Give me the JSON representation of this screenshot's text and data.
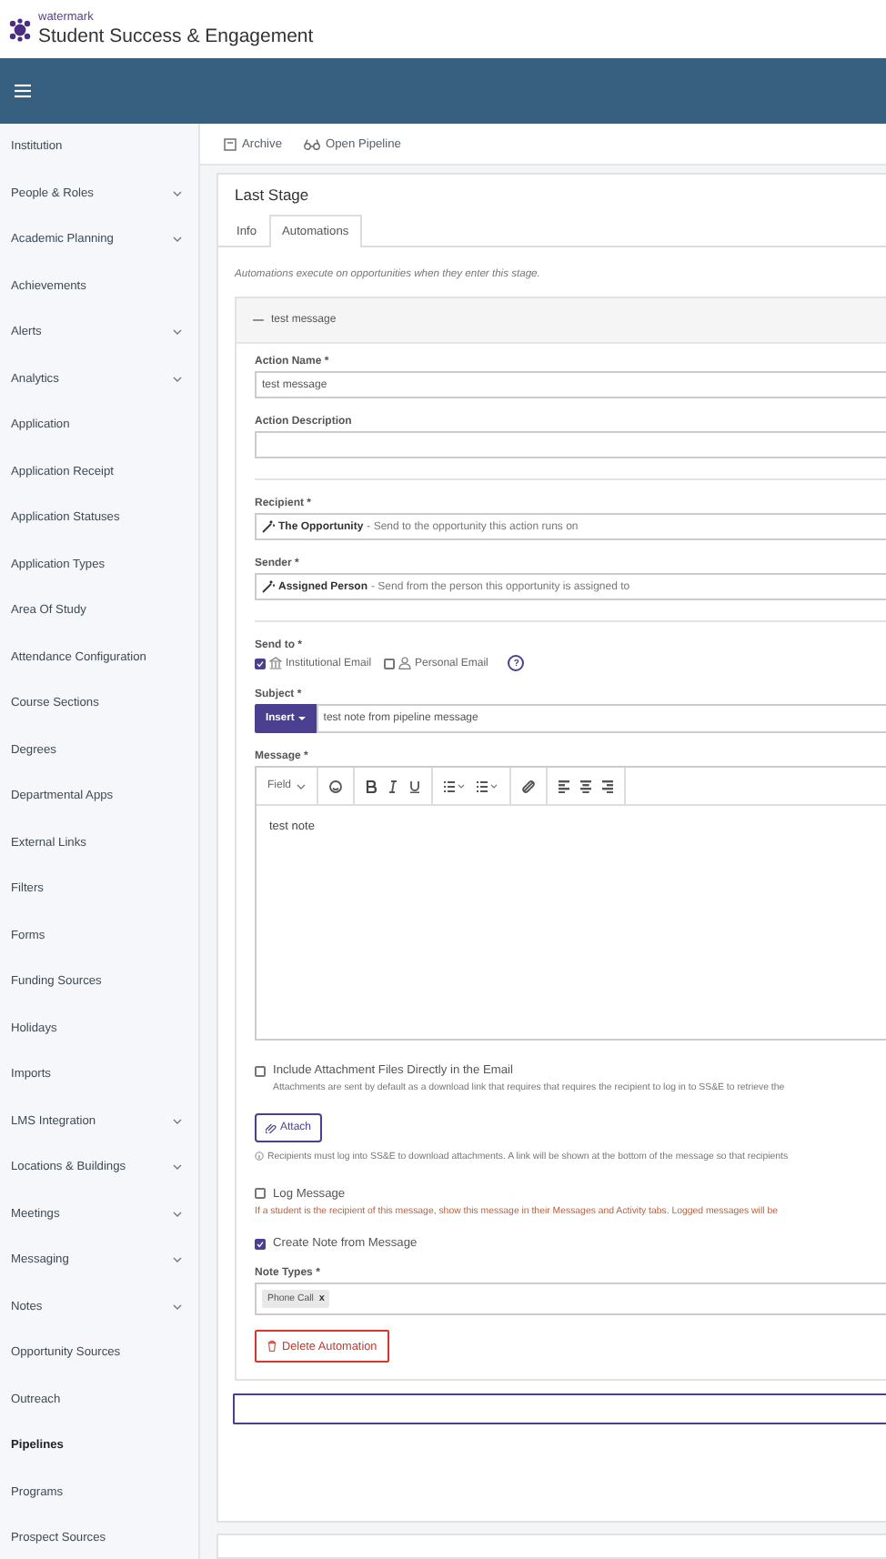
{
  "header": {
    "brand_small": "watermark",
    "brand": "Student Success & Engagement"
  },
  "sidebar": {
    "items": [
      {
        "label": "Institution",
        "expandable": false,
        "selected": false
      },
      {
        "label": "People & Roles",
        "expandable": true,
        "selected": false
      },
      {
        "label": "Academic Planning",
        "expandable": true,
        "selected": false
      },
      {
        "label": "Achievements",
        "expandable": false,
        "selected": false
      },
      {
        "label": "Alerts",
        "expandable": true,
        "selected": false
      },
      {
        "label": "Analytics",
        "expandable": true,
        "selected": false
      },
      {
        "label": "Application",
        "expandable": false,
        "selected": false
      },
      {
        "label": "Application Receipt",
        "expandable": false,
        "selected": false
      },
      {
        "label": "Application Statuses",
        "expandable": false,
        "selected": false
      },
      {
        "label": "Application Types",
        "expandable": false,
        "selected": false
      },
      {
        "label": "Area Of Study",
        "expandable": false,
        "selected": false
      },
      {
        "label": "Attendance Configuration",
        "expandable": false,
        "selected": false
      },
      {
        "label": "Course Sections",
        "expandable": false,
        "selected": false
      },
      {
        "label": "Degrees",
        "expandable": false,
        "selected": false
      },
      {
        "label": "Departmental Apps",
        "expandable": false,
        "selected": false
      },
      {
        "label": "External Links",
        "expandable": false,
        "selected": false
      },
      {
        "label": "Filters",
        "expandable": false,
        "selected": false
      },
      {
        "label": "Forms",
        "expandable": false,
        "selected": false
      },
      {
        "label": "Funding Sources",
        "expandable": false,
        "selected": false
      },
      {
        "label": "Holidays",
        "expandable": false,
        "selected": false
      },
      {
        "label": "Imports",
        "expandable": false,
        "selected": false
      },
      {
        "label": "LMS Integration",
        "expandable": true,
        "selected": false
      },
      {
        "label": "Locations & Buildings",
        "expandable": true,
        "selected": false
      },
      {
        "label": "Meetings",
        "expandable": true,
        "selected": false
      },
      {
        "label": "Messaging",
        "expandable": true,
        "selected": false
      },
      {
        "label": "Notes",
        "expandable": true,
        "selected": false
      },
      {
        "label": "Opportunity Sources",
        "expandable": false,
        "selected": false
      },
      {
        "label": "Outreach",
        "expandable": false,
        "selected": false
      },
      {
        "label": "Pipelines",
        "expandable": false,
        "selected": true
      },
      {
        "label": "Programs",
        "expandable": false,
        "selected": false
      },
      {
        "label": "Prospect Sources",
        "expandable": false,
        "selected": false
      }
    ]
  },
  "toolbar": [
    {
      "kind": "archive",
      "label": "Archive"
    },
    {
      "kind": "pipeline",
      "label": "Open Pipeline"
    }
  ],
  "stage": {
    "title": "Last Stage",
    "tabs": [
      {
        "label": "Info",
        "selected": false
      },
      {
        "label": "Automations",
        "selected": true
      }
    ],
    "intro": "Automations execute on opportunities when they enter this stage.",
    "automation": {
      "title": "test message",
      "expanded": true,
      "action_name": {
        "label": "Action Name *",
        "value": "test message"
      },
      "action_description": {
        "label": "Action Description"
      },
      "recipient": {
        "label": "Recipient *",
        "strong": "The Opportunity",
        "text": "- Send to the opportunity this action runs on"
      },
      "sender": {
        "label": "Sender *",
        "strong": "Assigned Person",
        "text": "- Send from the person this opportunity is assigned to"
      },
      "send_to": {
        "label": "Send to *",
        "help": "?",
        "options": [
          {
            "kind": "building",
            "label": "Institutional Email",
            "checked": true
          },
          {
            "kind": "person",
            "label": "Personal Email",
            "checked": false
          }
        ]
      },
      "subject": {
        "label": "Subject *",
        "insert": "Insert",
        "value": "test note from pipeline message"
      },
      "message": {
        "label": "Message *",
        "field": "Field",
        "body": "test note"
      },
      "include_attachments": {
        "label": "Include Attachment Files Directly in the Email",
        "checked": false,
        "hint": "Attachments are sent by default as a download link that requires that requires the recipient to log in to SS&E to retrieve the"
      },
      "attach": "Attach",
      "attach_note": "Recipients must log into SS&E to download attachments. A link will be shown at the bottom of the message so that recipients",
      "log_message": {
        "label": "Log Message",
        "checked": false,
        "hint": "If a student is the recipient of this message, show this message in their Messages and Activity tabs. Logged messages will be"
      },
      "create_note": {
        "label": "Create Note from Message",
        "checked": true
      },
      "note_types": {
        "label": "Note Types *",
        "tags": [
          {
            "label": "Phone Call",
            "remove": "x"
          }
        ]
      },
      "delete": "Delete Automation"
    }
  }
}
